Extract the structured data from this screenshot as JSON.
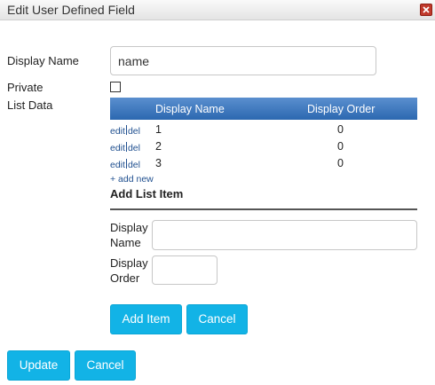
{
  "dialog": {
    "title": "Edit User Defined Field"
  },
  "form": {
    "display_name_label": "Display Name",
    "display_name_value": "name",
    "private_label": "Private",
    "private_checked": false,
    "list_data_label": "List Data"
  },
  "list_grid": {
    "columns": [
      "Display Name",
      "Display Order"
    ],
    "rows": [
      {
        "edit": "edit",
        "del": "del",
        "name": "1",
        "order": "0"
      },
      {
        "edit": "edit",
        "del": "del",
        "name": "2",
        "order": "0"
      },
      {
        "edit": "edit",
        "del": "del",
        "name": "3",
        "order": "0"
      }
    ],
    "add_new_label": "+ add new"
  },
  "add_list_item": {
    "title": "Add List Item",
    "display_name_label_line1": "Display",
    "display_name_label_line2": "Name",
    "display_name_value": "",
    "display_order_label_line1": "Display",
    "display_order_label_line2": "Order",
    "display_order_value": "",
    "add_button": "Add Item",
    "cancel_button": "Cancel"
  },
  "footer": {
    "update_button": "Update",
    "cancel_button": "Cancel"
  },
  "colors": {
    "accent": "#12b3e6",
    "grid_header": "#2c68b0",
    "link": "#1f4f8f",
    "close": "#c0392b"
  }
}
